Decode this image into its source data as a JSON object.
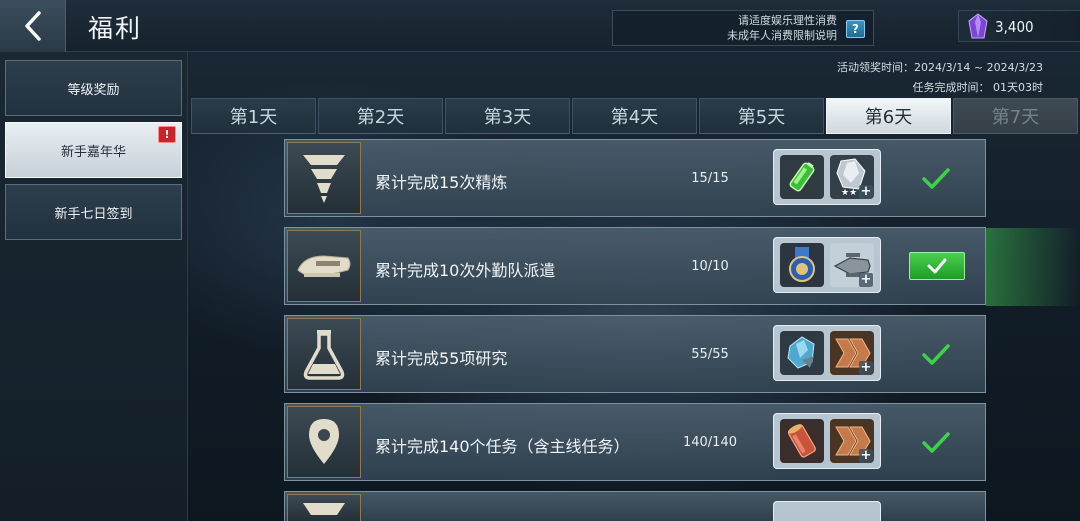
{
  "header": {
    "title": "福利",
    "notice_line1": "请适度娱乐理性消费",
    "notice_line2": "未成年人消费限制说明",
    "help_label": "?",
    "currency_value": "3,400",
    "currency_icon": "purple-crystal-icon"
  },
  "sidebar": {
    "items": [
      {
        "label": "等级奖励",
        "active": false
      },
      {
        "label": "新手嘉年华",
        "active": true,
        "badge": "!"
      },
      {
        "label": "新手七日签到",
        "active": false
      }
    ]
  },
  "event_info": {
    "claim_period": "活动领奖时间：2024/3/14 ~ 2024/3/23",
    "task_time": "任务完成时间：  01天03时"
  },
  "tabs": [
    {
      "label": "第1天",
      "state": "normal"
    },
    {
      "label": "第2天",
      "state": "normal"
    },
    {
      "label": "第3天",
      "state": "normal"
    },
    {
      "label": "第4天",
      "state": "normal"
    },
    {
      "label": "第5天",
      "state": "normal"
    },
    {
      "label": "第6天",
      "state": "active"
    },
    {
      "label": "第7天",
      "state": "locked"
    }
  ],
  "tasks": [
    {
      "name": "累计完成15次精炼",
      "progress": "15/15",
      "icon": "refine-icon",
      "rewards": [
        "green-battery-icon",
        "silver-crystal-icon"
      ],
      "status": "done"
    },
    {
      "name": "累计完成10次外勤队派遣",
      "progress": "10/10",
      "icon": "shuttle-icon",
      "rewards": [
        "medal-icon",
        "ship-icon"
      ],
      "status": "claimable"
    },
    {
      "name": "累计完成55项研究",
      "progress": "55/55",
      "icon": "flask-icon",
      "rewards": [
        "blue-crystal-icon",
        "chevron-rank-icon"
      ],
      "status": "done"
    },
    {
      "name": "累计完成140个任务（含主线任务）",
      "progress": "140/140",
      "icon": "location-pin-icon",
      "rewards": [
        "red-canister-icon",
        "chevron-rank-icon"
      ],
      "status": "done"
    }
  ],
  "colors": {
    "accent_green": "#2fb63a",
    "check_green": "#3cd24a",
    "badge_red": "#c7252b",
    "crystal_purple": "#8a4fe0"
  }
}
